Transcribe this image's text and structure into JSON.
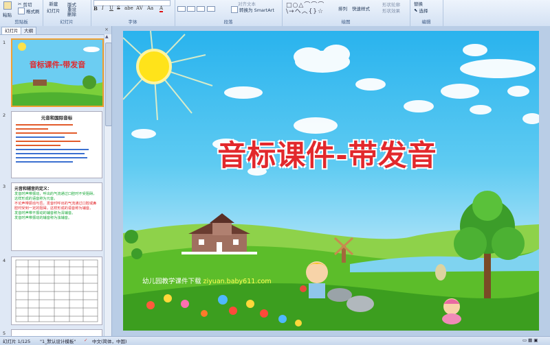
{
  "ribbon": {
    "clipboard": {
      "paste": "粘贴",
      "cut": "剪切",
      "format_painter": "格式刷",
      "label": "剪贴板"
    },
    "slides": {
      "new_slide": "新建",
      "new_slide2": "幻灯片",
      "layout": "版式",
      "reset": "重设",
      "delete": "删除",
      "label": "幻灯片"
    },
    "font": {
      "label": "字体",
      "bold": "B",
      "italic": "I",
      "underline": "U",
      "strike": "S",
      "shadow": "abe",
      "spacing": "AV",
      "case": "Aa",
      "color": "A"
    },
    "paragraph": {
      "label": "段落",
      "text_direction": "对齐文本",
      "smartart": "转换为 SmartArt"
    },
    "drawing": {
      "label": "绘图",
      "arrange": "排列",
      "quick_styles": "快速样式",
      "shape_fill": "形状轮廓",
      "shape_effects": "形状效果"
    },
    "editing": {
      "label": "编辑",
      "replace": "替换",
      "select": "选择"
    }
  },
  "left_pane": {
    "tabs": [
      "幻灯片",
      "大纲"
    ],
    "close": "×",
    "slides": [
      {
        "num": "1",
        "title": "音标课件-带发音"
      },
      {
        "num": "2",
        "title": "元音和国际音标"
      },
      {
        "num": "3",
        "title": "元音和辅音的定义：",
        "bullets": [
          "发音时声带振动，呼出的气流通过口腔时不受阻碍，这样形成的语音称为元音。",
          "不论声带振动与否，发音时呼出的气流通过口腔或鼻腔时受到一定的阻碍，这样形成的语音称为辅音。",
          "发音时声带不振动的辅音称为清辅音。",
          "发音时声带振动的辅音称为浊辅音。"
        ]
      },
      {
        "num": "4"
      },
      {
        "num": "5"
      }
    ]
  },
  "slide": {
    "title": "音标课件-带发音",
    "credit_text": "幼儿园教学课件下载",
    "credit_url": "ziyuan.baby611.com"
  },
  "status_bar": {
    "slide_count": "幻灯片 1/125",
    "theme": "\"1_默认设计模板\"",
    "language": "中文(简体，中国)"
  }
}
